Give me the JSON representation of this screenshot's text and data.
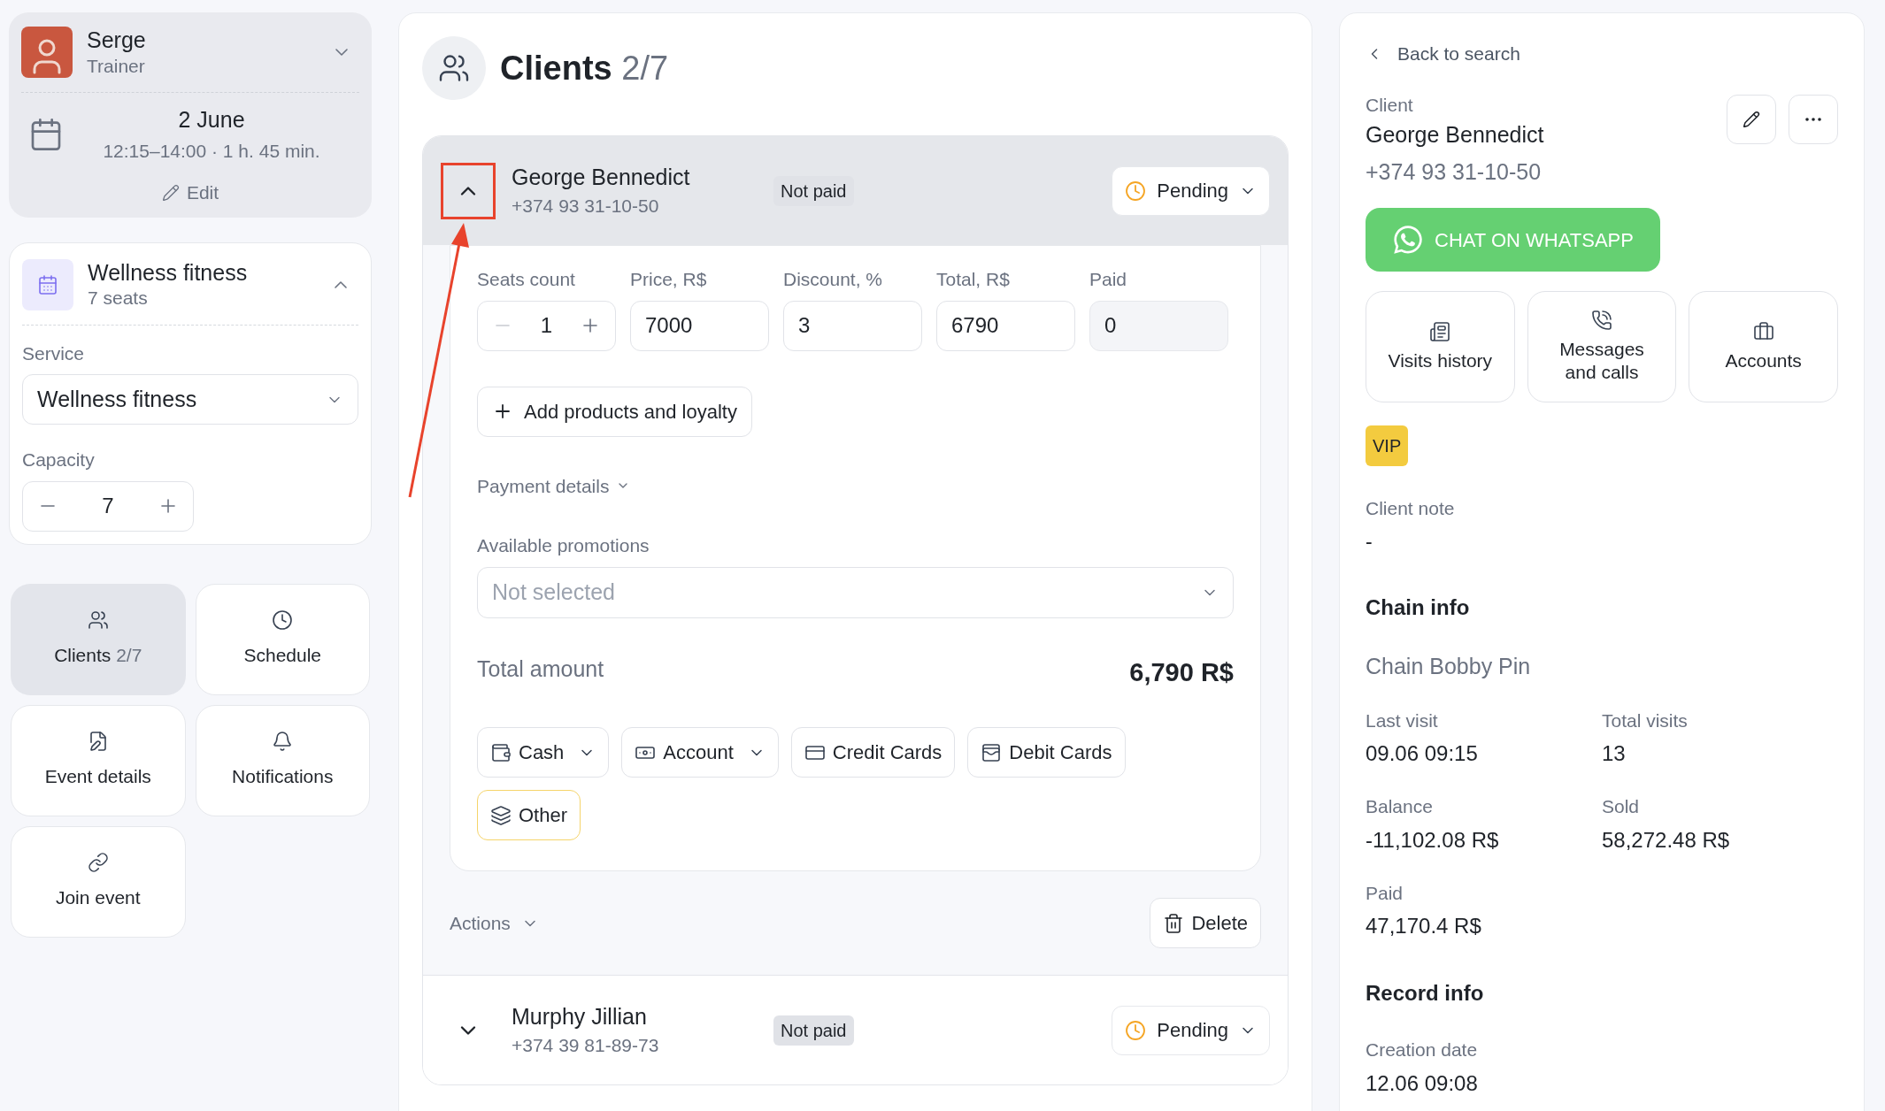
{
  "user": {
    "name": "Serge",
    "role": "Trainer"
  },
  "event": {
    "date": "2 June",
    "time": "12:15–14:00 · 1 h. 45 min.",
    "edit_label": "Edit"
  },
  "service_card": {
    "title": "Wellness fitness",
    "subtitle": "7 seats",
    "expanded": true,
    "service_label": "Service",
    "service_value": "Wellness fitness",
    "capacity_label": "Capacity",
    "capacity_value": "7",
    "decrement_disabled": false
  },
  "nav_tiles": [
    {
      "kind": "clients",
      "label": "Clients",
      "count": "2/7",
      "selected": true
    },
    {
      "kind": "schedule",
      "label": "Schedule",
      "selected": false
    },
    {
      "kind": "details",
      "label": "Event details",
      "selected": false
    },
    {
      "kind": "notifications",
      "label": "Notifications",
      "selected": false
    },
    {
      "kind": "join",
      "label": "Join event",
      "selected": false
    }
  ],
  "page": {
    "title": "Clients",
    "count": "2/7"
  },
  "clients": [
    {
      "name": "George Bennedict",
      "phone": "+374 93 31-10-50",
      "payment_badge": "Not paid",
      "status": "Pending",
      "expanded": true,
      "highlighted": true
    },
    {
      "name": "Murphy Jillian",
      "phone": "+374 39 81-89-73",
      "payment_badge": "Not paid",
      "status": "Pending",
      "expanded": false,
      "highlighted": false
    }
  ],
  "booking_form": {
    "fields": [
      {
        "kind": "stepper",
        "label": "Seats count",
        "value": "1",
        "decrement_disabled": true
      },
      {
        "kind": "input",
        "label": "Price, R$",
        "value": "7000"
      },
      {
        "kind": "input",
        "label": "Discount, %",
        "value": "3"
      },
      {
        "kind": "input",
        "label": "Total, R$",
        "value": "6790"
      },
      {
        "kind": "readonly",
        "label": "Paid",
        "value": "0"
      }
    ],
    "add_button": "Add products and loyalty",
    "payment_details": "Payment details",
    "promotions_label": "Available promotions",
    "promotions_placeholder": "Not selected",
    "total_label": "Total amount",
    "total_value": "6,790 R$",
    "payment_methods": [
      {
        "kind": "cash",
        "label": "Cash",
        "has_menu": true,
        "selected": false
      },
      {
        "kind": "account",
        "label": "Account",
        "has_menu": true,
        "selected": false
      },
      {
        "kind": "credit",
        "label": "Credit Cards",
        "has_menu": false,
        "selected": false
      },
      {
        "kind": "debit",
        "label": "Debit Cards",
        "has_menu": false,
        "selected": false
      },
      {
        "kind": "other",
        "label": "Other",
        "has_menu": false,
        "selected": true
      }
    ],
    "actions_label": "Actions",
    "delete_label": "Delete"
  },
  "detail": {
    "back": "Back to search",
    "label": "Client",
    "name": "George Bennedict",
    "phone": "+374 93 31-10-50",
    "whatsapp": "CHAT ON WHATSAPP",
    "tiles": [
      {
        "kind": "visits",
        "label": "Visits history"
      },
      {
        "kind": "messages",
        "label": "Messages and calls"
      },
      {
        "kind": "accounts",
        "label": "Accounts"
      }
    ],
    "tags": [
      "VIP"
    ],
    "note_label": "Client note",
    "note": "-",
    "chain_heading": "Chain info",
    "chain_name": "Chain Bobby Pin",
    "stats": [
      {
        "label": "Last visit",
        "value": "09.06 09:15"
      },
      {
        "label": "Total visits",
        "value": "13"
      },
      {
        "label": "Balance",
        "value": "-11,102.08 R$"
      },
      {
        "label": "Sold",
        "value": "58,272.48 R$"
      },
      {
        "label": "Paid",
        "value": "47,170.4 R$"
      }
    ],
    "record_heading": "Record info",
    "record": [
      {
        "label": "Creation date",
        "value": "12.06 09:08"
      }
    ]
  }
}
